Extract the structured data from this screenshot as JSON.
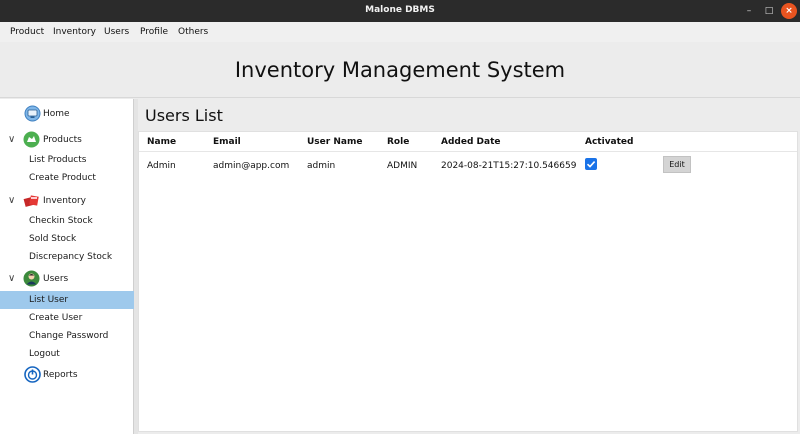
{
  "window": {
    "title": "Malone DBMS",
    "minimize": "–",
    "maximize": "□",
    "close": "×"
  },
  "menubar": {
    "items": [
      "Product",
      "Inventory",
      "Users",
      "Profile",
      "Others"
    ]
  },
  "header": {
    "title": "Inventory Management System"
  },
  "sidebar": {
    "home": "Home",
    "products": {
      "label": "Products",
      "children": [
        "List Products",
        "Create Product"
      ]
    },
    "inventory": {
      "label": "Inventory",
      "children": [
        "Checkin Stock",
        "Sold Stock",
        "Discrepancy Stock"
      ]
    },
    "users": {
      "label": "Users",
      "children": [
        "List User",
        "Create User",
        "Change Password",
        "Logout"
      ],
      "selected": "List User"
    },
    "reports": "Reports",
    "expand_glyph": "∨"
  },
  "main": {
    "title": "Users List",
    "columns": [
      "Name",
      "Email",
      "User Name",
      "Role",
      "Added Date",
      "Activated"
    ],
    "rows": [
      {
        "name": "Admin",
        "email": "admin@app.com",
        "username": "admin",
        "role": "ADMIN",
        "added_date": "2024-08-21T15:27:10.546659",
        "activated": true,
        "action": "Edit"
      }
    ]
  },
  "colors": {
    "selected_row": "#9ec9ec",
    "checkbox": "#1a73e8",
    "close_button": "#e95420"
  },
  "icons": {
    "home": "home-monitor-icon",
    "products": "products-icon",
    "inventory": "inventory-boxes-icon",
    "users": "user-avatar-icon",
    "reports": "reports-power-icon"
  }
}
